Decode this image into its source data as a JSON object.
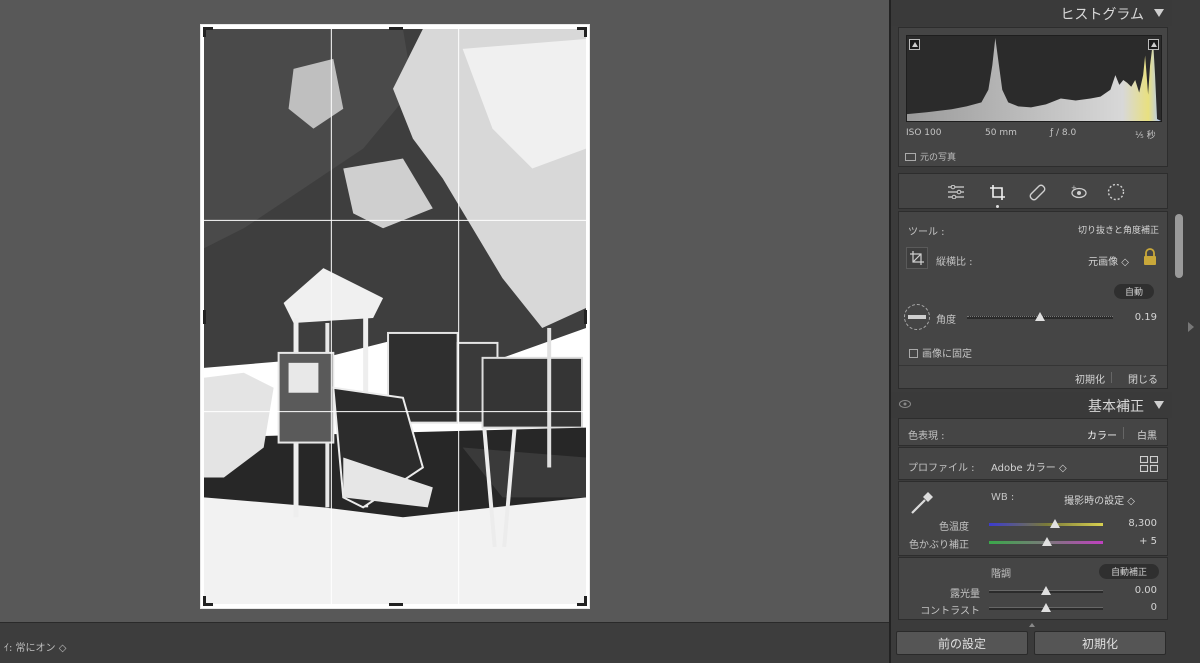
{
  "toolbar": {
    "overlay_label": "ｲ: 常にオン ◇"
  },
  "histogram": {
    "title": "ヒストグラム",
    "iso": "ISO 100",
    "focal": "50 mm",
    "aperture": "ƒ / 8.0",
    "shutter": "⅕ 秒",
    "original_photo": "元の写真"
  },
  "tools": [
    "sliders-icon",
    "crop-icon",
    "heal-icon",
    "redeye-icon",
    "mask-icon"
  ],
  "crop": {
    "tool_label": "ツール :",
    "tool_value": "切り抜きと角度補正",
    "aspect_label": "縦横比 :",
    "aspect_value": "元画像 ◇",
    "auto_button": "自動",
    "angle_label": "角度",
    "angle_value": "0.19",
    "constrain_label": "画像に固定",
    "reset_label": "初期化",
    "close_label": "閉じる"
  },
  "basic": {
    "title": "基本補正",
    "treatment_label": "色表現 :",
    "color_label": "カラー",
    "bw_label": "白黒",
    "profile_label": "プロファイル :",
    "profile_value": "Adobe カラー ◇",
    "wb_label": "WB :",
    "wb_value": "撮影時の設定 ◇",
    "temp_label": "色温度",
    "temp_value": "8,300",
    "tint_label": "色かぶり補正",
    "tint_value": "+ 5",
    "tone_label": "階調",
    "auto_tone_button": "自動補正",
    "exposure_label": "露光量",
    "exposure_value": "0.00",
    "contrast_label": "コントラスト",
    "contrast_value": "0"
  },
  "buttons": {
    "previous": "前の設定",
    "reset": "初期化"
  },
  "slider_levels": {
    "angle": 0.5,
    "temp": 0.58,
    "tint": 0.51,
    "exposure": 0.5,
    "contrast": 0.5
  }
}
